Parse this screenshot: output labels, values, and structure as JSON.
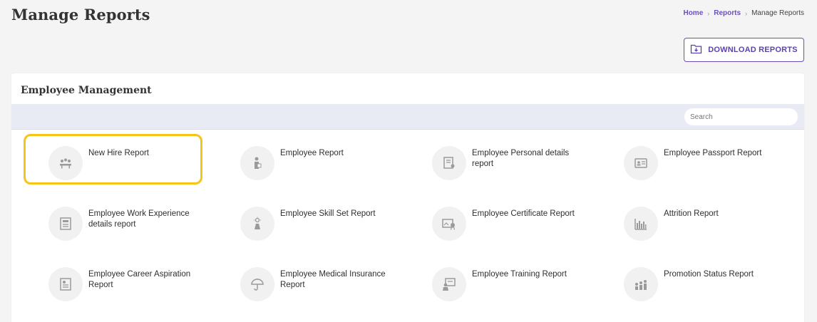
{
  "header": {
    "title": "Manage Reports",
    "breadcrumb": [
      {
        "label": "Home"
      },
      {
        "label": "Reports"
      },
      {
        "label": "Manage Reports"
      }
    ]
  },
  "toolbar": {
    "download_label": "DOWNLOAD REPORTS"
  },
  "card": {
    "title": "Employee Management",
    "search_placeholder": "Search"
  },
  "reports": [
    {
      "label": "New Hire Report",
      "icon": "team-meeting-icon"
    },
    {
      "label": "Employee Report",
      "icon": "employee-icon"
    },
    {
      "label": "Employee Personal details report",
      "icon": "personal-details-icon"
    },
    {
      "label": "Employee Passport Report",
      "icon": "passport-card-icon"
    },
    {
      "label": "Employee Work Experience details report",
      "icon": "document-list-icon"
    },
    {
      "label": "Employee Skill Set Report",
      "icon": "skill-idea-icon"
    },
    {
      "label": "Employee Certificate Report",
      "icon": "certificate-icon"
    },
    {
      "label": "Attrition Report",
      "icon": "bar-chart-icon"
    },
    {
      "label": "Employee Career Aspiration Report",
      "icon": "career-document-icon"
    },
    {
      "label": "Employee Medical Insurance Report",
      "icon": "umbrella-icon"
    },
    {
      "label": "Employee Training Report",
      "icon": "training-board-icon"
    },
    {
      "label": "Promotion Status Report",
      "icon": "promotion-people-icon"
    }
  ],
  "colors": {
    "accent": "#6b4fbb",
    "highlight": "#f5c518",
    "toolbar_bg": "#e8ebf3",
    "icon_gray": "#9a9a9a"
  }
}
